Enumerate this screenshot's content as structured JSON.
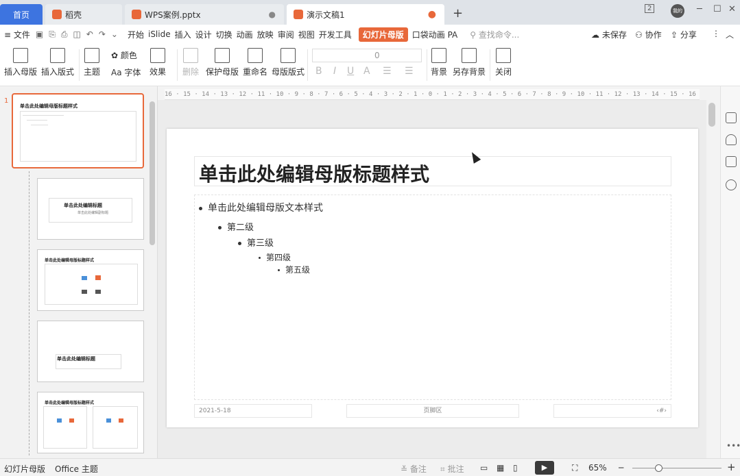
{
  "tabs": [
    {
      "label": "首页"
    },
    {
      "label": "稻壳"
    },
    {
      "label": "WPS案例.pptx"
    },
    {
      "label": "演示文稿1"
    }
  ],
  "tab_add": "+",
  "window": {
    "badge": "2",
    "avatar": "我的",
    "min": "─",
    "max": "☐",
    "close": "✕"
  },
  "menu": {
    "file": "≡ 文件",
    "items": [
      "开始",
      "iSlide",
      "插入",
      "设计",
      "切换",
      "动画",
      "放映",
      "审阅",
      "视图",
      "开发工具"
    ],
    "master_tab": "幻灯片母版",
    "extra": [
      "口袋动画 PA"
    ],
    "search_placeholder": "查找命令...",
    "unsaved": "未保存",
    "collab": "协作",
    "share": "分享"
  },
  "ribbon": {
    "insert_master": "插入母版",
    "insert_layout": "插入版式",
    "theme": "主题",
    "color": "颜色",
    "font": "Aa 字体",
    "effect": "效果",
    "delete": "删除",
    "protect_master": "保护母版",
    "rename": "重命名",
    "master_layout": "母版版式",
    "font_size": "0",
    "bold": "B",
    "italic": "I",
    "underline": "U",
    "fontcolor": "A",
    "background": "背景",
    "save_background": "另存背景",
    "close": "关闭"
  },
  "ruler": "16 · 15 · 14 · 13 · 12 · 11 · 10 · 9 · 8 · 7 · 6 · 5 · 4 · 3 · 2 · 1 · 0 · 1 · 2 · 3 · 4 · 5 · 6 · 7 · 8 · 9 · 10 · 11 · 12 · 13 · 14 · 15 · 16",
  "thumbnails": {
    "slide_number": "1",
    "t1_title": "单击此处编辑母版标题样式",
    "t2_title": "单击此处编辑标题",
    "t2_sub": "单击此处编辑副标题",
    "t3_title": "单击此处编辑母版标题样式",
    "t4_title": "单击此处编辑标题",
    "t5_title": "单击此处编辑母版标题样式"
  },
  "slide": {
    "title": "单击此处编辑母版标题样式",
    "levels": [
      "单击此处编辑母版文本样式",
      "第二级",
      "第三级",
      "第四级",
      "第五级"
    ],
    "footer_date": "2021-5-18",
    "footer_center": "页脚区",
    "footer_num": "‹#›"
  },
  "status": {
    "left1": "幻灯片母版",
    "left2": "Office 主题",
    "notes": "备注",
    "comments": "批注",
    "zoom": "65%",
    "minus": "─",
    "plus": "+"
  }
}
